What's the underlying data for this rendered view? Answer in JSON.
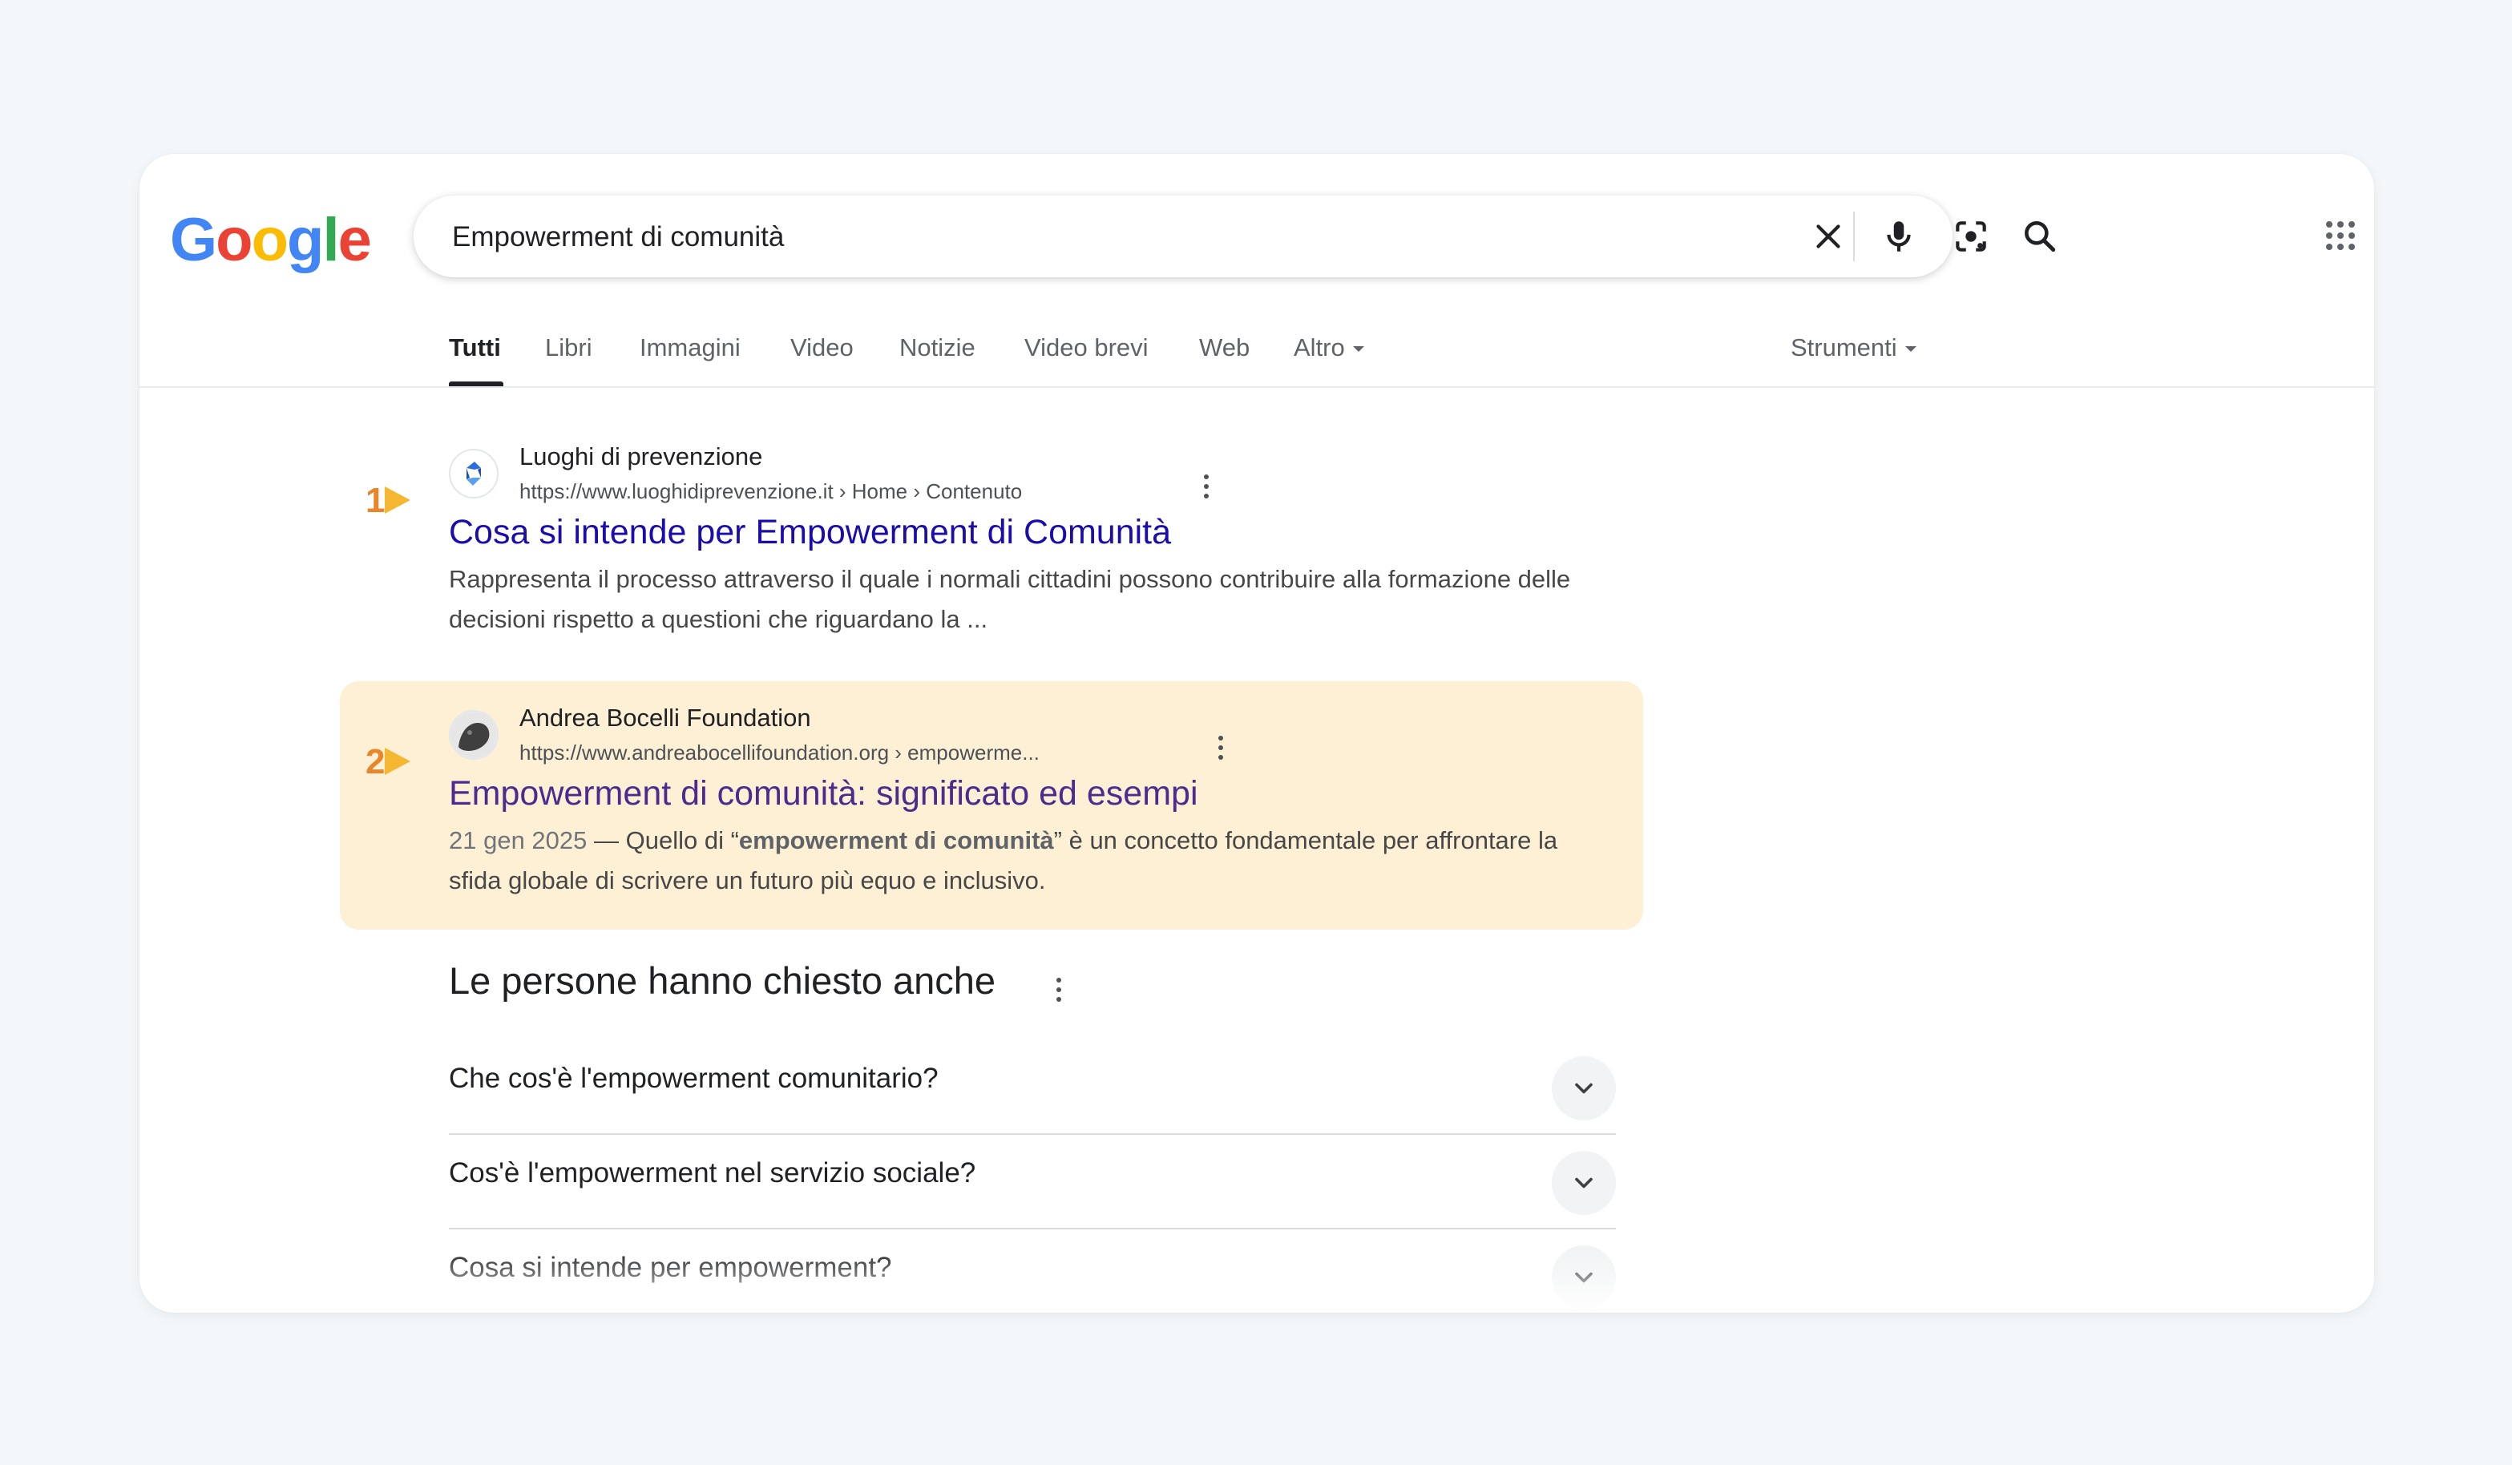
{
  "logo": {
    "letters": [
      "G",
      "o",
      "o",
      "g",
      "l",
      "e"
    ],
    "colors": [
      "#4285f4",
      "#ea4335",
      "#fbbc05",
      "#4285f4",
      "#34a853",
      "#ea4335"
    ]
  },
  "search": {
    "query": "Empowerment di comunità"
  },
  "icons": {
    "clear": "close-icon",
    "voice": "microphone-icon",
    "lens": "camera-lens-icon",
    "search": "search-icon",
    "apps": "apps-grid-icon"
  },
  "tabs": [
    {
      "label": "Tutti",
      "active": true
    },
    {
      "label": "Libri"
    },
    {
      "label": "Immagini"
    },
    {
      "label": "Video"
    },
    {
      "label": "Notizie"
    },
    {
      "label": "Video brevi"
    },
    {
      "label": "Web"
    },
    {
      "label": "Altro"
    }
  ],
  "tools_label": "Strumenti",
  "results": [
    {
      "marker": "1",
      "site_name": "Luoghi di prevenzione",
      "url": "https://www.luoghidiprevenzione.it › Home › Contenuto",
      "title": "Cosa si intende per Empowerment di Comunità",
      "snippet": "Rappresenta il processo attraverso il quale i normali cittadini possono contribuire alla formazione delle decisioni rispetto a questioni che riguardano la ..."
    },
    {
      "marker": "2",
      "site_name": "Andrea Bocelli Foundation",
      "url": "https://www.andreabocellifoundation.org › empowerme...",
      "title": "Empowerment di comunità: significato ed esempi",
      "date": "21 gen 2025",
      "snippet_pre": " — Quello di “",
      "snippet_bold": "empowerment di comunità",
      "snippet_post": "” è un concetto fondamentale per affrontare la sfida globale di scrivere un futuro più equo e inclusivo.",
      "highlighted": true
    }
  ],
  "paa": {
    "title": "Le persone hanno chiesto anche",
    "questions": [
      "Che cos'è l'empowerment comunitario?",
      "Cos'è l'empowerment nel servizio sociale?",
      "Cosa si intende per empowerment?"
    ]
  },
  "colors": {
    "link": "#1a0dab",
    "visited": "#4e2a8e",
    "highlight": "#fdf0d4",
    "marker_number": "#e8862b",
    "marker_arrow": "#f5b731"
  }
}
